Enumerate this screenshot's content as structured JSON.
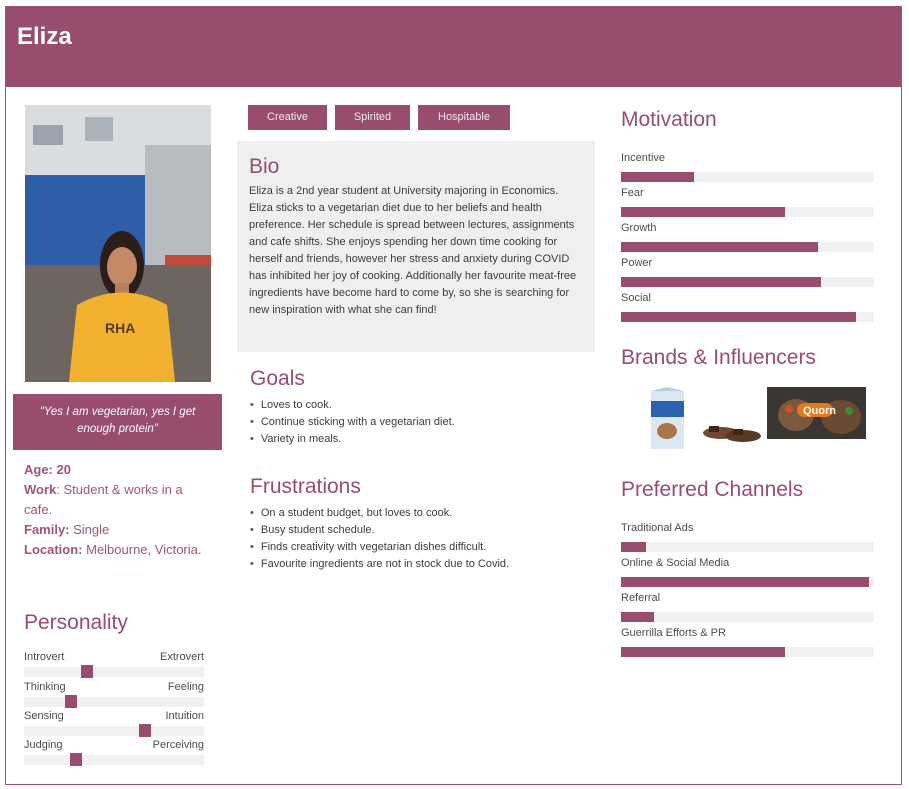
{
  "header": {
    "name": "Eliza"
  },
  "quote": "\"Yes I am vegetarian, yes I get enough protein\"",
  "facts": {
    "age_label": "Age:",
    "age_value": " 20",
    "work_label": "Work",
    "work_value": ": Student & works in a cafe.",
    "family_label": "Family:",
    "family_value": " Single",
    "location_label": "Location:",
    "location_value": " Melbourne, Victoria."
  },
  "personality": {
    "title": "Personality",
    "traits": [
      {
        "left": "Introvert",
        "right": "Extrovert",
        "value": 0.35
      },
      {
        "left": "Thinking",
        "right": "Feeling",
        "value": 0.26
      },
      {
        "left": "Sensing",
        "right": "Intuition",
        "value": 0.67
      },
      {
        "left": "Judging",
        "right": "Perceiving",
        "value": 0.29
      }
    ]
  },
  "tags": [
    "Creative",
    "Spirited",
    "Hospitable"
  ],
  "bio": {
    "title": "Bio",
    "text": "Eliza is a 2nd year student at University majoring in Economics. Eliza sticks to a vegetarian diet due to her beliefs and health preference. Her schedule is spread between lectures, assignments and cafe shifts. She enjoys spending her down time cooking for herself and friends, however her stress and anxiety during COVID has inhibited her joy of cooking. Additionally her favourite meat-free ingredients have become hard to come by, so she is searching for new inspiration with what she can find!"
  },
  "goals": {
    "title": "Goals",
    "items": [
      "Loves to cook.",
      "Continue sticking with a vegetarian diet.",
      "Variety in meals."
    ]
  },
  "frustrations": {
    "title": "Frustrations",
    "items": [
      "On a student budget, but loves to cook.",
      "Busy student schedule.",
      "Finds creativity with vegetarian dishes difficult.",
      "Favourite ingredients are not in stock due to Covid."
    ]
  },
  "motivation": {
    "title": "Motivation",
    "items": [
      {
        "label": "Incentive",
        "value": 0.29
      },
      {
        "label": "Fear",
        "value": 0.65
      },
      {
        "label": "Growth",
        "value": 0.78
      },
      {
        "label": "Power",
        "value": 0.79
      },
      {
        "label": "Social",
        "value": 0.93
      }
    ]
  },
  "brands": {
    "title": "Brands & Influencers",
    "quorn_logo": "Quorn"
  },
  "channels": {
    "title": "Preferred Channels",
    "items": [
      {
        "label": "Traditional Ads",
        "value": 0.1
      },
      {
        "label": "Online & Social Media",
        "value": 0.98
      },
      {
        "label": "Referral",
        "value": 0.13
      },
      {
        "label": "Guerrilla Efforts & PR",
        "value": 0.65
      }
    ]
  },
  "colors": {
    "accent": "#984d6f",
    "track": "#f1f1f1",
    "panel": "#efefef"
  }
}
